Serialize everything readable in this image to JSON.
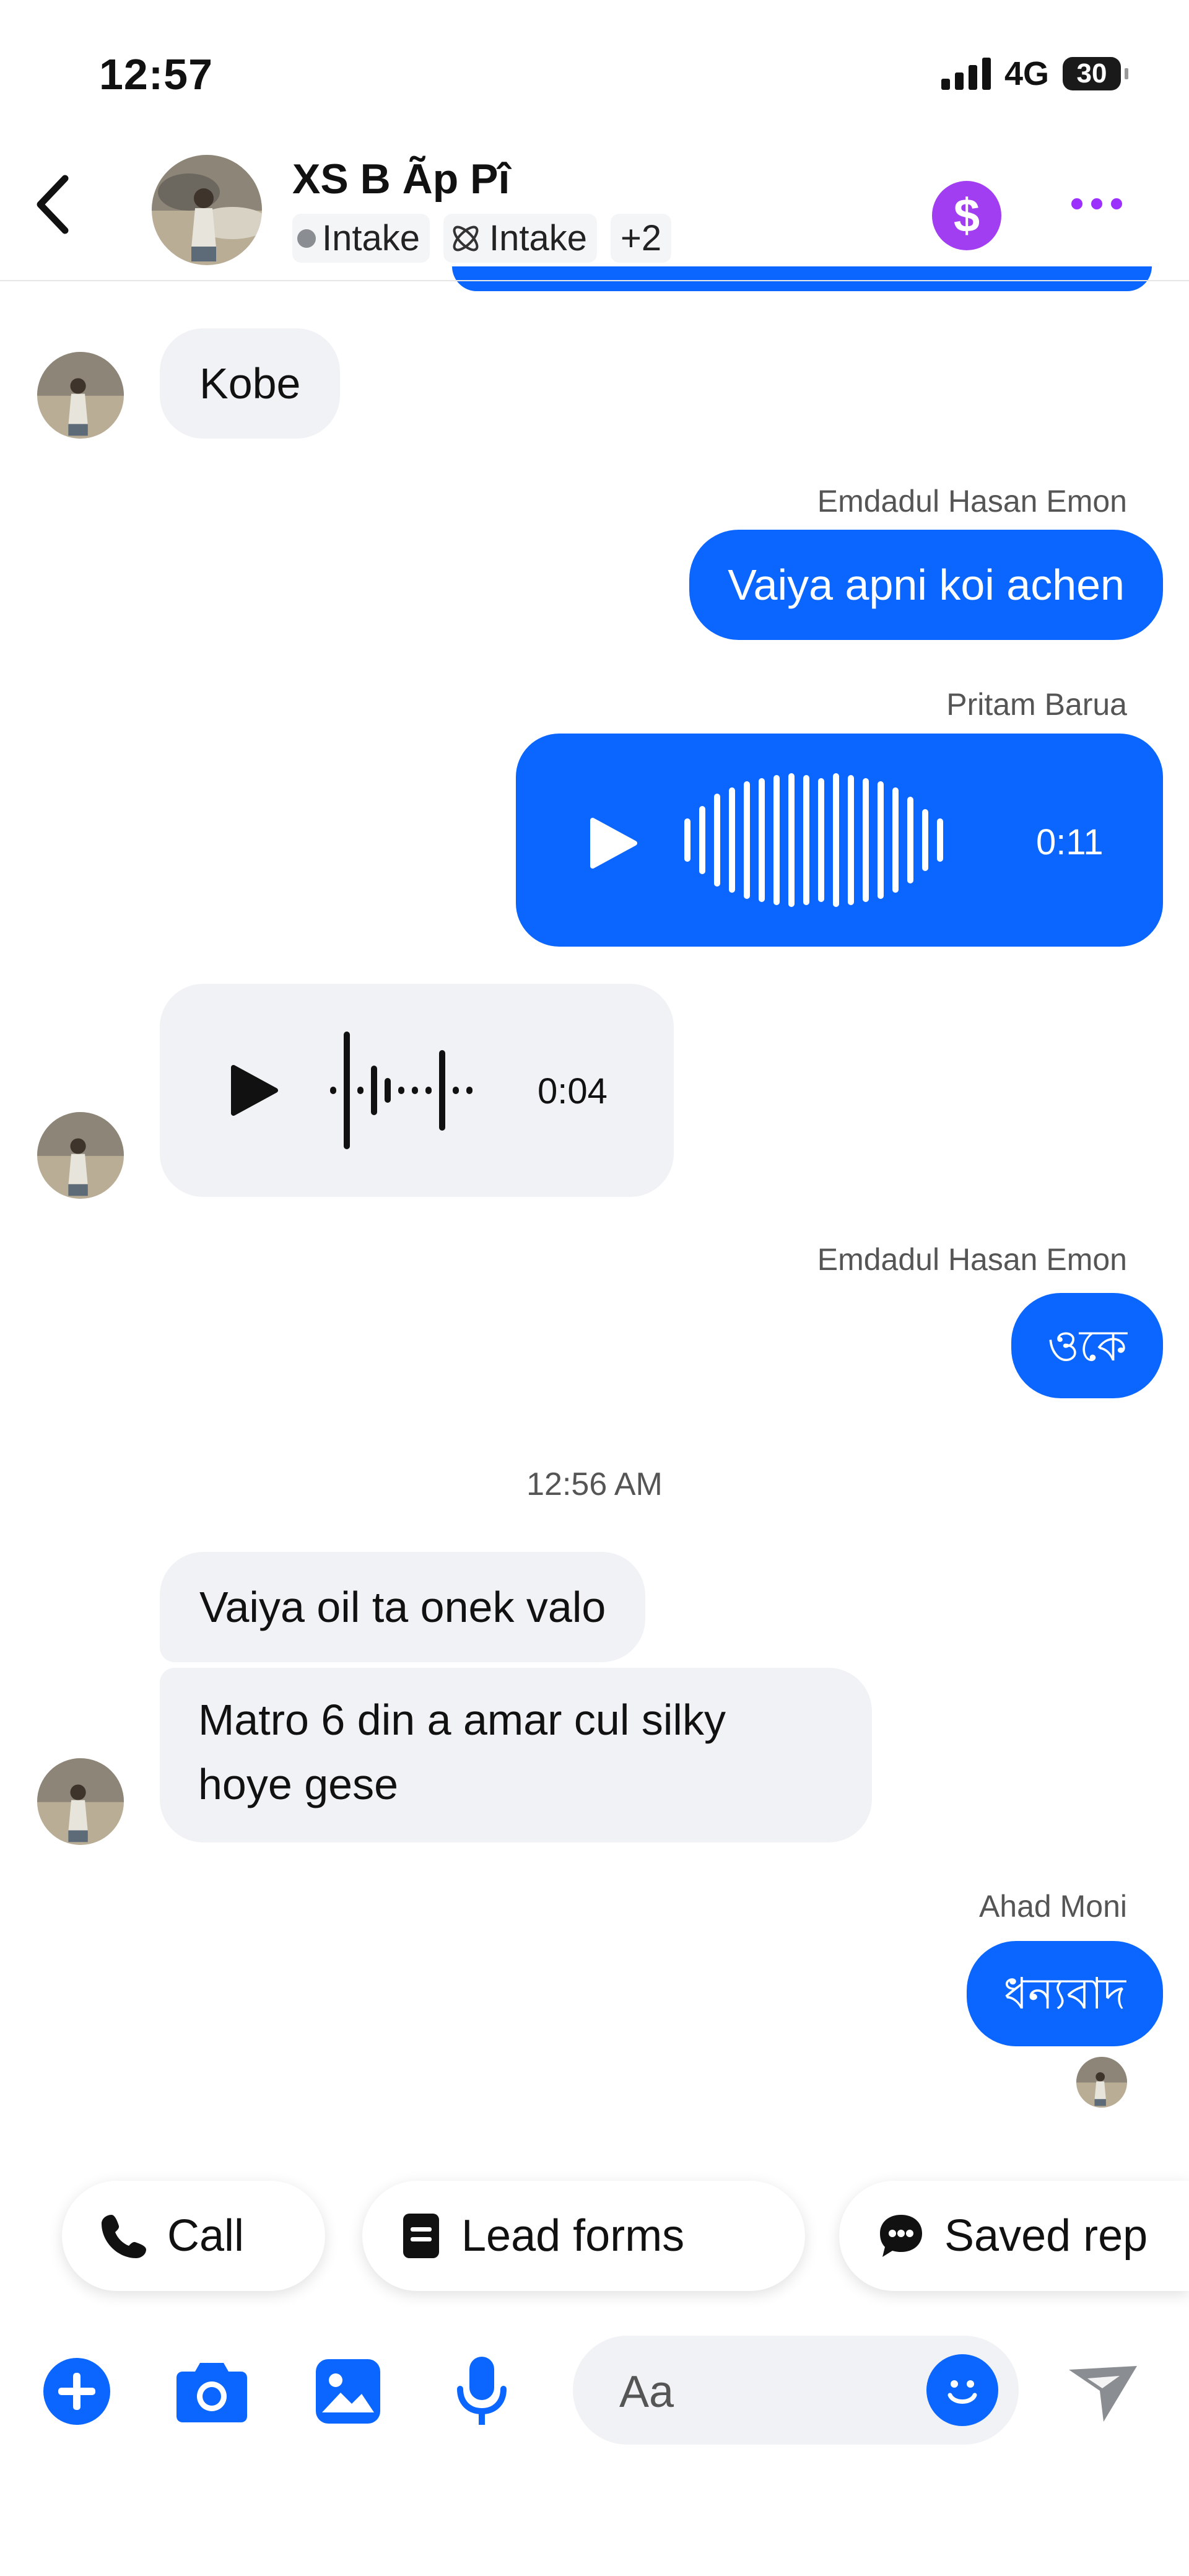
{
  "status_bar": {
    "time": "12:57",
    "network": "4G",
    "battery": "30"
  },
  "header": {
    "title": "XS B Ãp Pî",
    "labels": [
      "Intake",
      "Intake"
    ],
    "more_labels": "+2"
  },
  "messages": [
    {
      "type": "in_text",
      "text": "Kobe"
    },
    {
      "type": "out_text",
      "sender": "Emdadul Hasan Emon",
      "text": "Vaiya apni koi achen"
    },
    {
      "type": "out_audio",
      "sender": "Pritam Barua",
      "duration": "0:11"
    },
    {
      "type": "in_audio",
      "duration": "0:04"
    },
    {
      "type": "out_text",
      "sender": "Emdadul Hasan Emon",
      "text": "ওকে"
    },
    {
      "type": "timestamp",
      "text": "12:56 AM"
    },
    {
      "type": "in_text",
      "text": "Vaiya oil ta onek valo"
    },
    {
      "type": "in_text",
      "lines": [
        "Matro 6 din a amar cul silky",
        "hoye gese"
      ]
    },
    {
      "type": "out_text",
      "sender": "Ahad Moni",
      "text": "ধন্যবাদ"
    }
  ],
  "quick_actions": [
    "Call",
    "Lead forms",
    "Saved rep"
  ],
  "composer": {
    "placeholder": "Aa"
  },
  "colors": {
    "accent": "#0a66ff",
    "incoming_bubble": "#f0f2f5",
    "dollar_badge": "#a23ef2"
  }
}
